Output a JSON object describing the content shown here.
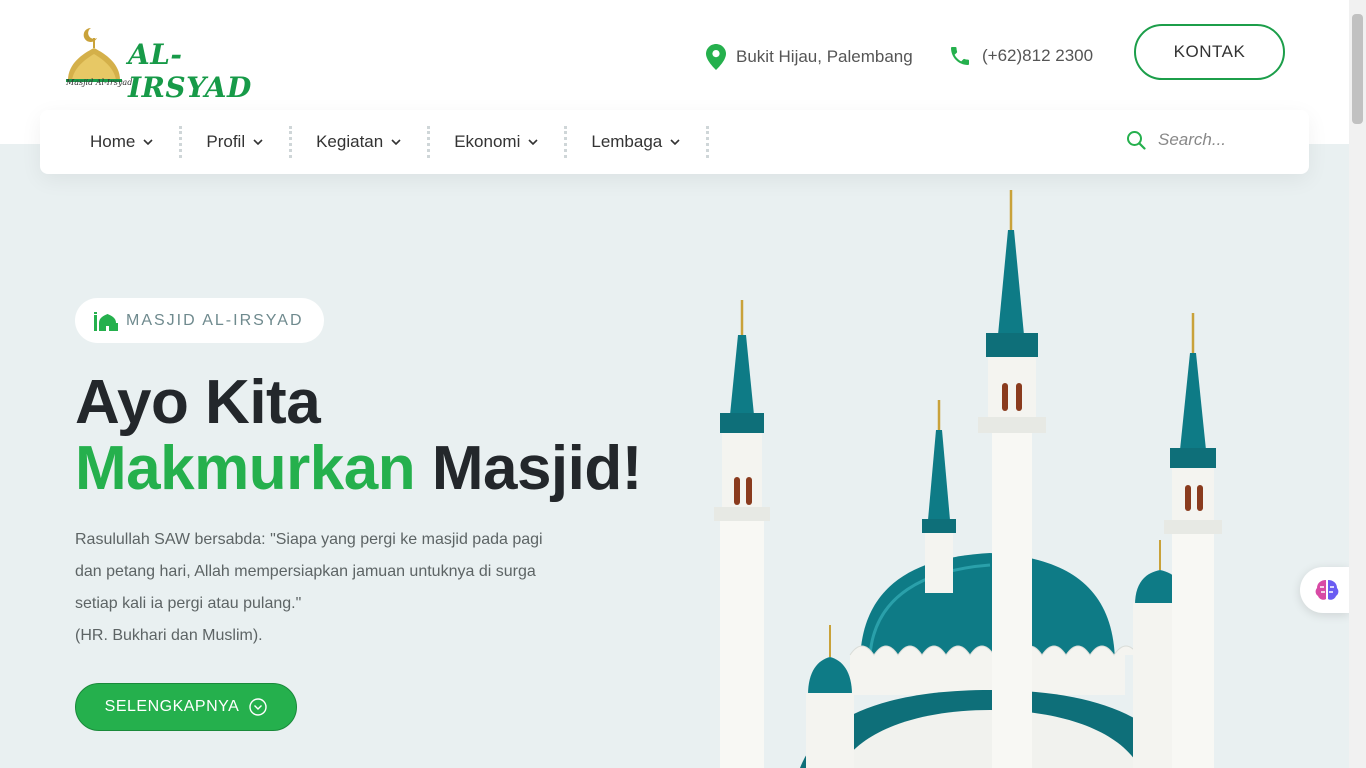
{
  "header": {
    "logo_text": "AL-IRSYAD",
    "logo_sub": "Masjid Al-Irsyad",
    "location": "Bukit Hijau, Palembang",
    "phone": "(+62)812 2300",
    "contact_button": "KONTAK"
  },
  "nav": {
    "items": [
      {
        "label": "Home"
      },
      {
        "label": "Profil"
      },
      {
        "label": "Kegiatan"
      },
      {
        "label": "Ekonomi"
      },
      {
        "label": "Lembaga"
      }
    ],
    "search_placeholder": "Search..."
  },
  "hero": {
    "badge": "MASJID AL-IRSYAD",
    "headline_line1": "Ayo Kita",
    "headline_green": "Makmurkan",
    "headline_rest": "Masjid!",
    "quote_lines": [
      "Rasulullah SAW bersabda: \"Siapa yang pergi ke masjid pada pagi",
      "dan petang hari, Allah mempersiapkan jamuan untuknya di surga",
      "setiap kali ia pergi atau pulang.\"",
      "(HR. Bukhari dan Muslim)."
    ],
    "button": "SELENGKAPNYA"
  },
  "colors": {
    "accent": "#25b04d",
    "logo_green": "#179a48",
    "background": "#e9f0f1",
    "dome": "#0e7b86"
  },
  "icons": [
    "map-pin-icon",
    "phone-icon",
    "chevron-down-icon",
    "search-icon",
    "mosque-icon",
    "chevron-circle-down-icon",
    "brain-icon"
  ]
}
